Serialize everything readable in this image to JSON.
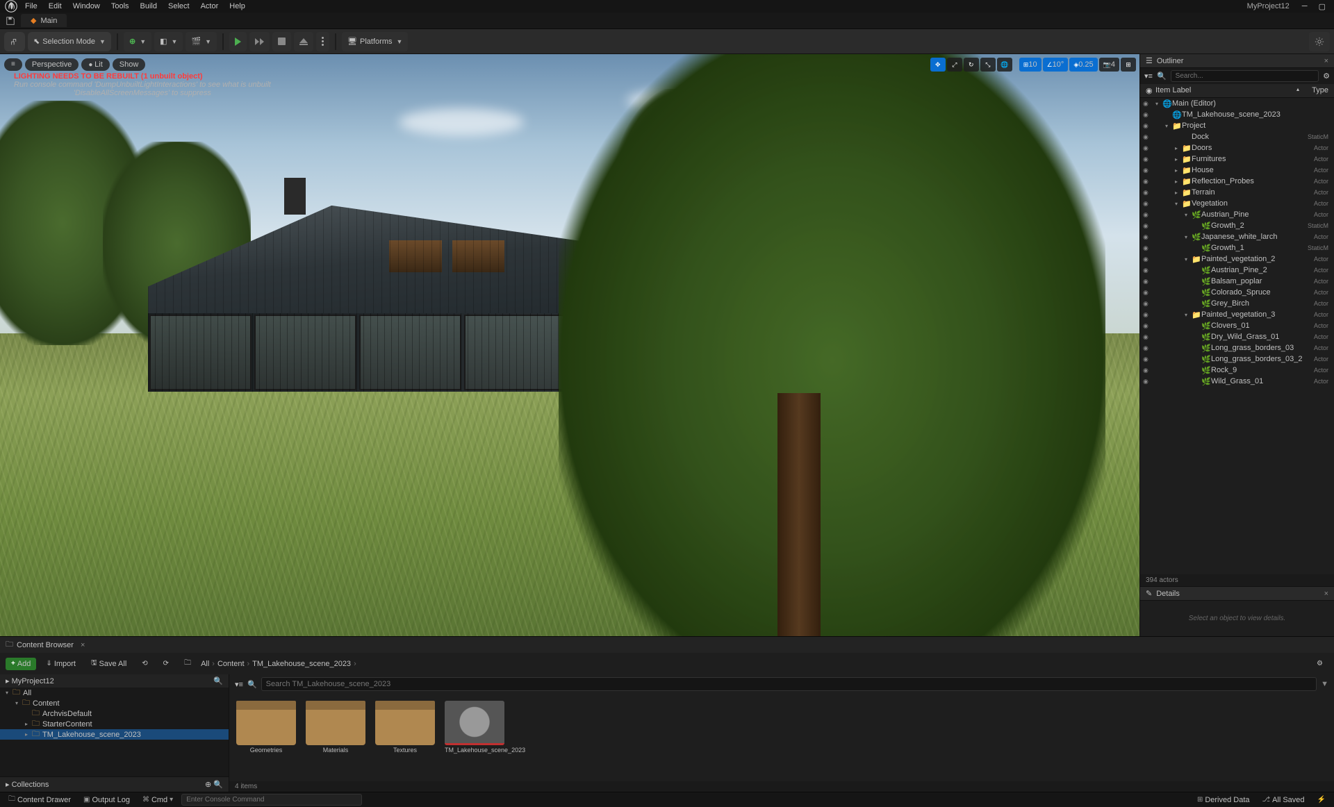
{
  "app": {
    "project_name": "MyProject12"
  },
  "menu": [
    "File",
    "Edit",
    "Window",
    "Tools",
    "Build",
    "Select",
    "Actor",
    "Help"
  ],
  "main_tab": {
    "label": "Main"
  },
  "toolbar": {
    "selection_mode": "Selection Mode",
    "platforms": "Platforms"
  },
  "viewport": {
    "menus": {
      "perspective": "Perspective",
      "lit": "Lit",
      "show": "Show"
    },
    "warning_bold": "LIGHTING NEEDS TO BE REBUILT (1 unbuilt object)",
    "warning_line2": "Run console command 'DumpUnbuiltLightInteractions' to see what is unbuilt",
    "warning_line3": "'DisableAllScreenMessages' to suppress",
    "tr_values": {
      "angle": "10",
      "angle2": "10°",
      "scale": "0.25",
      "cam": "4"
    }
  },
  "outliner": {
    "title": "Outliner",
    "search_placeholder": "Search...",
    "col_item": "Item Label",
    "col_type": "Type",
    "actor_count": "394 actors",
    "rows": [
      {
        "indent": 0,
        "expand": "▾",
        "icon": "🌐",
        "label": "Main (Editor)",
        "type": ""
      },
      {
        "indent": 1,
        "expand": "",
        "icon": "🌐",
        "label": "TM_Lakehouse_scene_2023",
        "type": ""
      },
      {
        "indent": 1,
        "expand": "▾",
        "icon": "📁",
        "label": "Project",
        "type": ""
      },
      {
        "indent": 2,
        "expand": "",
        "icon": "",
        "label": "Dock",
        "type": "StaticM"
      },
      {
        "indent": 2,
        "expand": "▸",
        "icon": "📁",
        "label": "Doors",
        "type": "Actor"
      },
      {
        "indent": 2,
        "expand": "▸",
        "icon": "📁",
        "label": "Furnitures",
        "type": "Actor"
      },
      {
        "indent": 2,
        "expand": "▸",
        "icon": "📁",
        "label": "House",
        "type": "Actor"
      },
      {
        "indent": 2,
        "expand": "▸",
        "icon": "📁",
        "label": "Reflection_Probes",
        "type": "Actor"
      },
      {
        "indent": 2,
        "expand": "▸",
        "icon": "📁",
        "label": "Terrain",
        "type": "Actor"
      },
      {
        "indent": 2,
        "expand": "▾",
        "icon": "📁",
        "label": "Vegetation",
        "type": "Actor"
      },
      {
        "indent": 3,
        "expand": "▾",
        "icon": "🌿",
        "label": "Austrian_Pine",
        "type": "Actor"
      },
      {
        "indent": 4,
        "expand": "",
        "icon": "🌿",
        "label": "Growth_2",
        "type": "StaticM"
      },
      {
        "indent": 3,
        "expand": "▾",
        "icon": "🌿",
        "label": "Japanese_white_larch",
        "type": "Actor"
      },
      {
        "indent": 4,
        "expand": "",
        "icon": "🌿",
        "label": "Growth_1",
        "type": "StaticM"
      },
      {
        "indent": 3,
        "expand": "▾",
        "icon": "📁",
        "label": "Painted_vegetation_2",
        "type": "Actor"
      },
      {
        "indent": 4,
        "expand": "",
        "icon": "🌿",
        "label": "Austrian_Pine_2",
        "type": "Actor"
      },
      {
        "indent": 4,
        "expand": "",
        "icon": "🌿",
        "label": "Balsam_poplar",
        "type": "Actor"
      },
      {
        "indent": 4,
        "expand": "",
        "icon": "🌿",
        "label": "Colorado_Spruce",
        "type": "Actor"
      },
      {
        "indent": 4,
        "expand": "",
        "icon": "🌿",
        "label": "Grey_Birch",
        "type": "Actor"
      },
      {
        "indent": 3,
        "expand": "▾",
        "icon": "📁",
        "label": "Painted_vegetation_3",
        "type": "Actor"
      },
      {
        "indent": 4,
        "expand": "",
        "icon": "🌿",
        "label": "Clovers_01",
        "type": "Actor"
      },
      {
        "indent": 4,
        "expand": "",
        "icon": "🌿",
        "label": "Dry_Wild_Grass_01",
        "type": "Actor"
      },
      {
        "indent": 4,
        "expand": "",
        "icon": "🌿",
        "label": "Long_grass_borders_03",
        "type": "Actor"
      },
      {
        "indent": 4,
        "expand": "",
        "icon": "🌿",
        "label": "Long_grass_borders_03_2",
        "type": "Actor"
      },
      {
        "indent": 4,
        "expand": "",
        "icon": "🌿",
        "label": "Rock_9",
        "type": "Actor"
      },
      {
        "indent": 4,
        "expand": "",
        "icon": "🌿",
        "label": "Wild_Grass_01",
        "type": "Actor"
      }
    ]
  },
  "details": {
    "title": "Details",
    "empty": "Select an object to view details."
  },
  "content_browser": {
    "tab": "Content Browser",
    "add": "Add",
    "import": "Import",
    "save_all": "Save All",
    "breadcrumb": [
      "All",
      "Content",
      "TM_Lakehouse_scene_2023"
    ],
    "project": "MyProject12",
    "tree": [
      {
        "indent": 0,
        "expand": "▾",
        "label": "All",
        "selected": false
      },
      {
        "indent": 1,
        "expand": "▾",
        "label": "Content",
        "selected": false
      },
      {
        "indent": 2,
        "expand": "",
        "label": "ArchvisDefault",
        "selected": false
      },
      {
        "indent": 2,
        "expand": "▸",
        "label": "StarterContent",
        "selected": false
      },
      {
        "indent": 2,
        "expand": "▸",
        "label": "TM_Lakehouse_scene_2023",
        "selected": true
      }
    ],
    "collections": "Collections",
    "search_placeholder": "Search TM_Lakehouse_scene_2023",
    "assets": [
      {
        "type": "folder",
        "label": "Geometries"
      },
      {
        "type": "folder",
        "label": "Materials"
      },
      {
        "type": "folder",
        "label": "Textures"
      },
      {
        "type": "level",
        "label": "TM_Lakehouse_scene_2023"
      }
    ],
    "footer": "4 items"
  },
  "statusbar": {
    "content_drawer": "Content Drawer",
    "output_log": "Output Log",
    "cmd": "Cmd",
    "cmd_placeholder": "Enter Console Command",
    "derived_data": "Derived Data",
    "all_saved": "All Saved"
  }
}
